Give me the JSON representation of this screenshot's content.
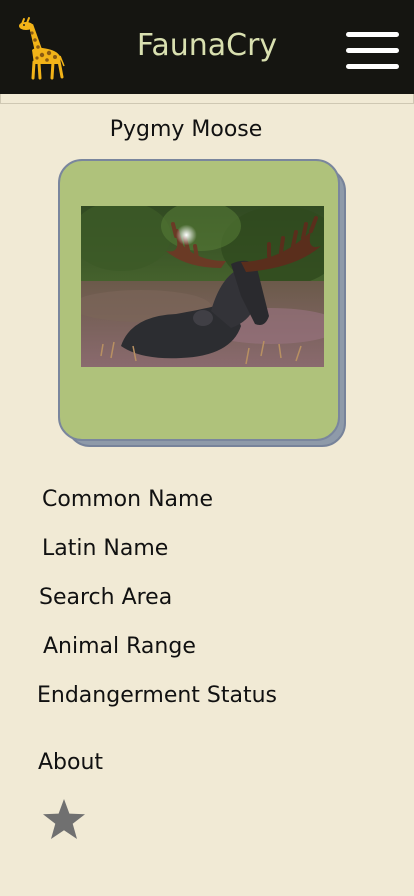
{
  "app": {
    "title": "FaunaCry",
    "logo_icon": "giraffe-icon",
    "menu_icon": "hamburger-menu-icon"
  },
  "animal": {
    "name": "Pygmy Moose",
    "image_description_icon": "moose-photo"
  },
  "nav": {
    "items": [
      {
        "label": "Common Name"
      },
      {
        "label": "Latin Name"
      },
      {
        "label": "Search Area"
      },
      {
        "label": "Animal Range"
      },
      {
        "label": "Endangerment Status"
      },
      {
        "label": "About"
      }
    ],
    "favorite_icon": "star-icon"
  },
  "colors": {
    "topbar": "#151511",
    "title_text": "#d9e0b0",
    "background": "#f1ead5",
    "card": "#afc27b",
    "card_shadow": "#8e9aa9",
    "star": "#707070"
  }
}
